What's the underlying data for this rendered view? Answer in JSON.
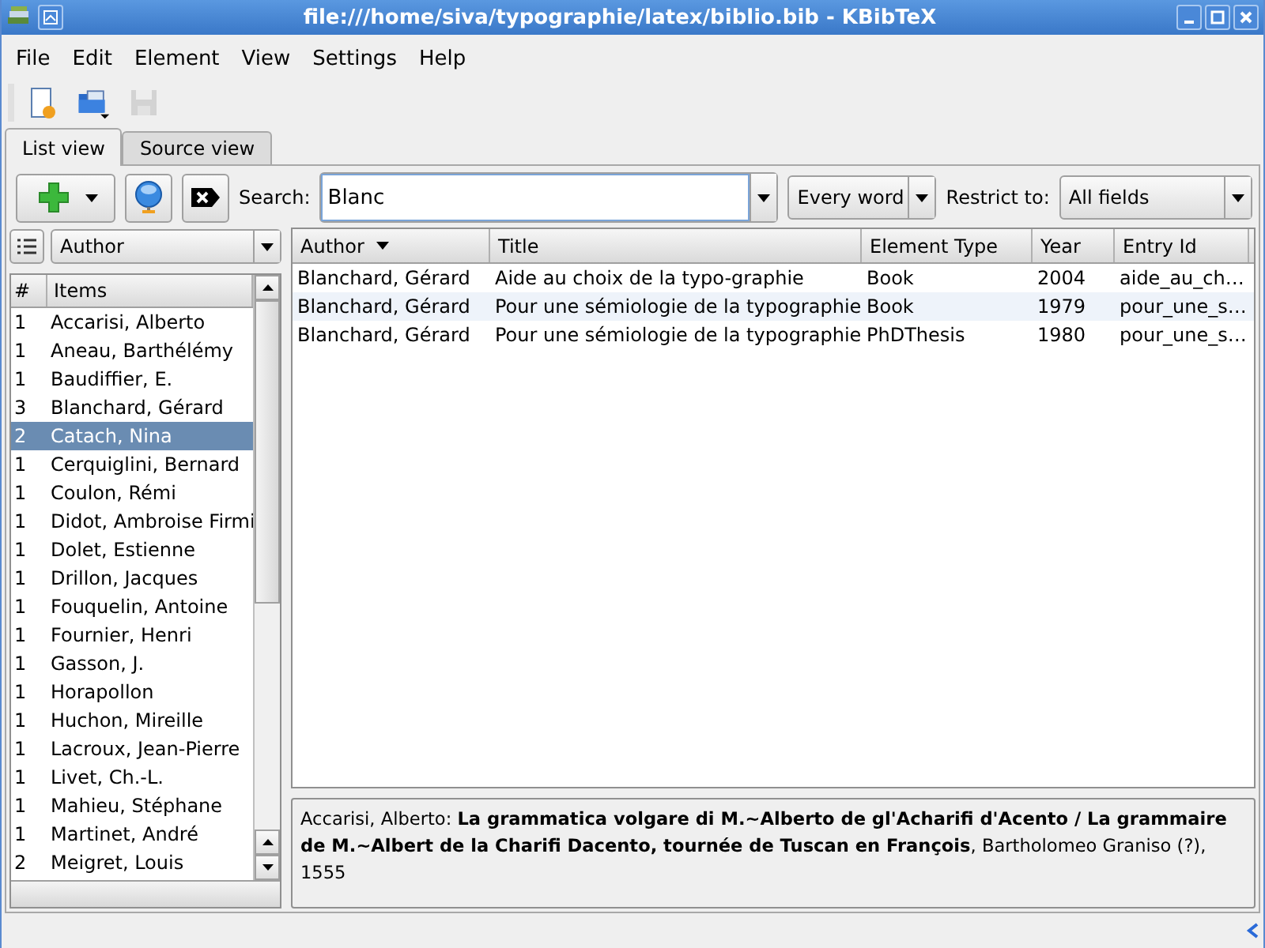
{
  "window": {
    "title": "file:///home/siva/typographie/latex/biblio.bib - KBibTeX"
  },
  "menu": [
    "File",
    "Edit",
    "Element",
    "View",
    "Settings",
    "Help"
  ],
  "toolbar": [
    {
      "kind": "new",
      "disabled": false
    },
    {
      "kind": "open",
      "disabled": false
    },
    {
      "kind": "save",
      "disabled": true
    }
  ],
  "tabs": [
    {
      "label": "List view",
      "selected": true
    },
    {
      "label": "Source view",
      "selected": false
    }
  ],
  "search": {
    "label": "Search:",
    "value": "Blanc"
  },
  "match_mode": {
    "value": "Every word"
  },
  "restrict": {
    "label": "Restrict to:",
    "value": "All fields"
  },
  "group_by": {
    "value": "Author"
  },
  "items_list": {
    "columns": [
      "#",
      "Items"
    ],
    "rows": [
      {
        "count": "1",
        "name": "Accarisi, Alberto",
        "selected": false
      },
      {
        "count": "1",
        "name": "Aneau, Barthélémy",
        "selected": false
      },
      {
        "count": "1",
        "name": "Baudiffier, E.",
        "selected": false
      },
      {
        "count": "3",
        "name": "Blanchard, Gérard",
        "selected": false
      },
      {
        "count": "2",
        "name": "Catach, Nina",
        "selected": true
      },
      {
        "count": "1",
        "name": "Cerquiglini, Bernard",
        "selected": false
      },
      {
        "count": "1",
        "name": "Coulon, Rémi",
        "selected": false
      },
      {
        "count": "1",
        "name": "Didot, Ambroise Firmi",
        "selected": false
      },
      {
        "count": "1",
        "name": "Dolet, Estienne",
        "selected": false
      },
      {
        "count": "1",
        "name": "Drillon, Jacques",
        "selected": false
      },
      {
        "count": "1",
        "name": "Fouquelin, Antoine",
        "selected": false
      },
      {
        "count": "1",
        "name": "Fournier, Henri",
        "selected": false
      },
      {
        "count": "1",
        "name": "Gasson, J.",
        "selected": false
      },
      {
        "count": "1",
        "name": "Horapollon",
        "selected": false
      },
      {
        "count": "1",
        "name": "Huchon, Mireille",
        "selected": false
      },
      {
        "count": "1",
        "name": "Lacroux, Jean-Pierre",
        "selected": false
      },
      {
        "count": "1",
        "name": "Livet, Ch.-L.",
        "selected": false
      },
      {
        "count": "1",
        "name": "Mahieu, Stéphane",
        "selected": false
      },
      {
        "count": "1",
        "name": "Martinet, André",
        "selected": false
      },
      {
        "count": "2",
        "name": "Meigret, Louis",
        "selected": false
      }
    ]
  },
  "entries": {
    "columns": [
      {
        "label": "Author",
        "sorted": true
      },
      {
        "label": "Title",
        "sorted": false
      },
      {
        "label": "Element Type",
        "sorted": false
      },
      {
        "label": "Year",
        "sorted": false
      },
      {
        "label": "Entry Id",
        "sorted": false
      }
    ],
    "rows": [
      [
        "Blanchard, Gérard",
        "Aide au choix de la typo-graphie",
        "Book",
        "2004",
        "aide_au_ch…"
      ],
      [
        "Blanchard, Gérard",
        "Pour une sémiologie de la typographie",
        "Book",
        "1979",
        "pour_une_s…"
      ],
      [
        "Blanchard, Gérard",
        "Pour une sémiologie de la typographie",
        "PhDThesis",
        "1980",
        "pour_une_s…"
      ]
    ]
  },
  "details": "Accarisi, Alberto: **La grammatica volgare di M.~Alberto de gl'Acharifi d'Acento / La grammaire de M.~Albert de la Charifi Dacento, tournée de Tuscan en François**, Bartholomeo Graniso (?), 1555"
}
